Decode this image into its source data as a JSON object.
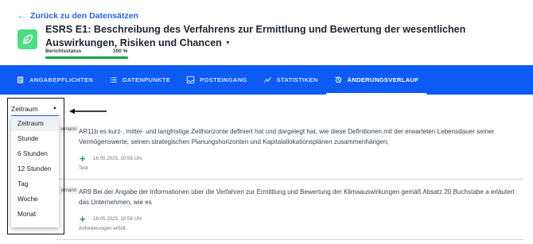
{
  "back_link": {
    "arrow": "←",
    "label": "Zurück zu den Datensätzen"
  },
  "logo": {
    "icon": "leaf-icon",
    "color": "#4ade80"
  },
  "header": {
    "title": "ESRS E1: Beschreibung des Verfahrens zur Ermittlung und Bewertung der wesentlichen Auswirkungen, Risiken und Chancen",
    "caret": "▾"
  },
  "status": {
    "label": "Berichtsstatus",
    "percent_label": "100 %",
    "progress": 1.0,
    "color": "#16a34a"
  },
  "nav": {
    "color": "#0d5bf5",
    "tabs": [
      {
        "label": "ANGABEPFLICHTEN",
        "icon": "document-icon",
        "active": false
      },
      {
        "label": "DATENPUNKTE",
        "icon": "list-icon",
        "active": false
      },
      {
        "label": "POSTEINGANG",
        "icon": "inbox-icon",
        "active": false
      },
      {
        "label": "STATISTIKEN",
        "icon": "chart-icon",
        "active": false
      },
      {
        "label": "ÄNDERUNGSVERLAUF",
        "icon": "history-icon",
        "active": true
      }
    ]
  },
  "filter": {
    "selected": "Zeitraum",
    "options": [
      "Zeitraum",
      "Stunde",
      "6 Stunden",
      "12 Stunden",
      "Tag",
      "Woche",
      "Monat"
    ]
  },
  "entries": [
    {
      "tag": "ernann",
      "text": "AR11b es kurz-, mittel- und langfristige Zeithorizonte definiert hat und dargelegt hat, wie diese Definitionen mit der erwarteten Lebensdauer seiner Vermögenswerte, seinen strategischen Planungshorizonten und Kapitalallokationsplänen zusammenhängen,",
      "plus": "+",
      "date": "16.05.2025, 10:56 Uhr",
      "note": "Test"
    },
    {
      "tag": "ernann",
      "text": "AR9 Bei der Angabe der Informationen über die Verfahren zur Ermittlung und Bewertung der Klimaauswirkungen gemäß Absatz 20 Buchstabe a erläutert das Unternehmen, wie es",
      "plus": "+",
      "date": "16.05.2025, 10:56 Uhr",
      "note": "Anforderungen erfüllt."
    }
  ]
}
